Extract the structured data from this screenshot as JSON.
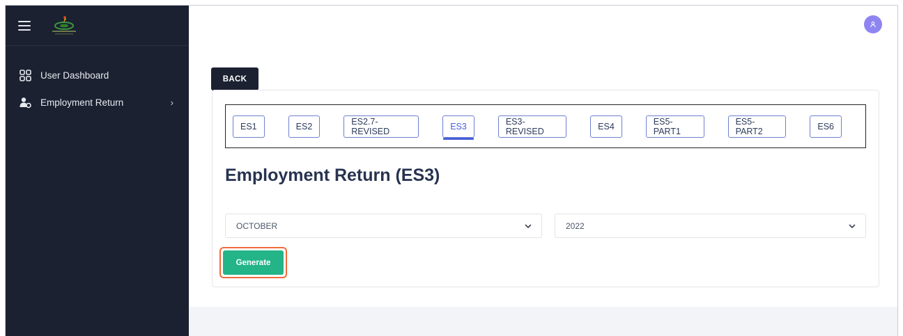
{
  "sidebar": {
    "items": [
      {
        "label": "User Dashboard",
        "icon": "dashboard-grid-icon"
      },
      {
        "label": "Employment Return",
        "icon": "user-settings-icon",
        "has_submenu": true
      }
    ]
  },
  "header": {
    "avatar_icon": "user-icon"
  },
  "main": {
    "back_label": "BACK",
    "tabs": [
      "ES1",
      "ES2",
      "ES2.7-REVISED",
      "ES3",
      "ES3-REVISED",
      "ES4",
      "ES5-PART1",
      "ES5-PART2",
      "ES6"
    ],
    "active_tab": "ES3",
    "title": "Employment Return (ES3)",
    "month_select": {
      "value": "OCTOBER"
    },
    "year_select": {
      "value": "2022"
    },
    "generate_label": "Generate"
  },
  "colors": {
    "sidebar_bg": "#1b2131",
    "accent": "#4a5ed8",
    "generate_bg": "#23b487",
    "highlight_border": "#f06b3a",
    "avatar_bg": "#8f85f0"
  }
}
